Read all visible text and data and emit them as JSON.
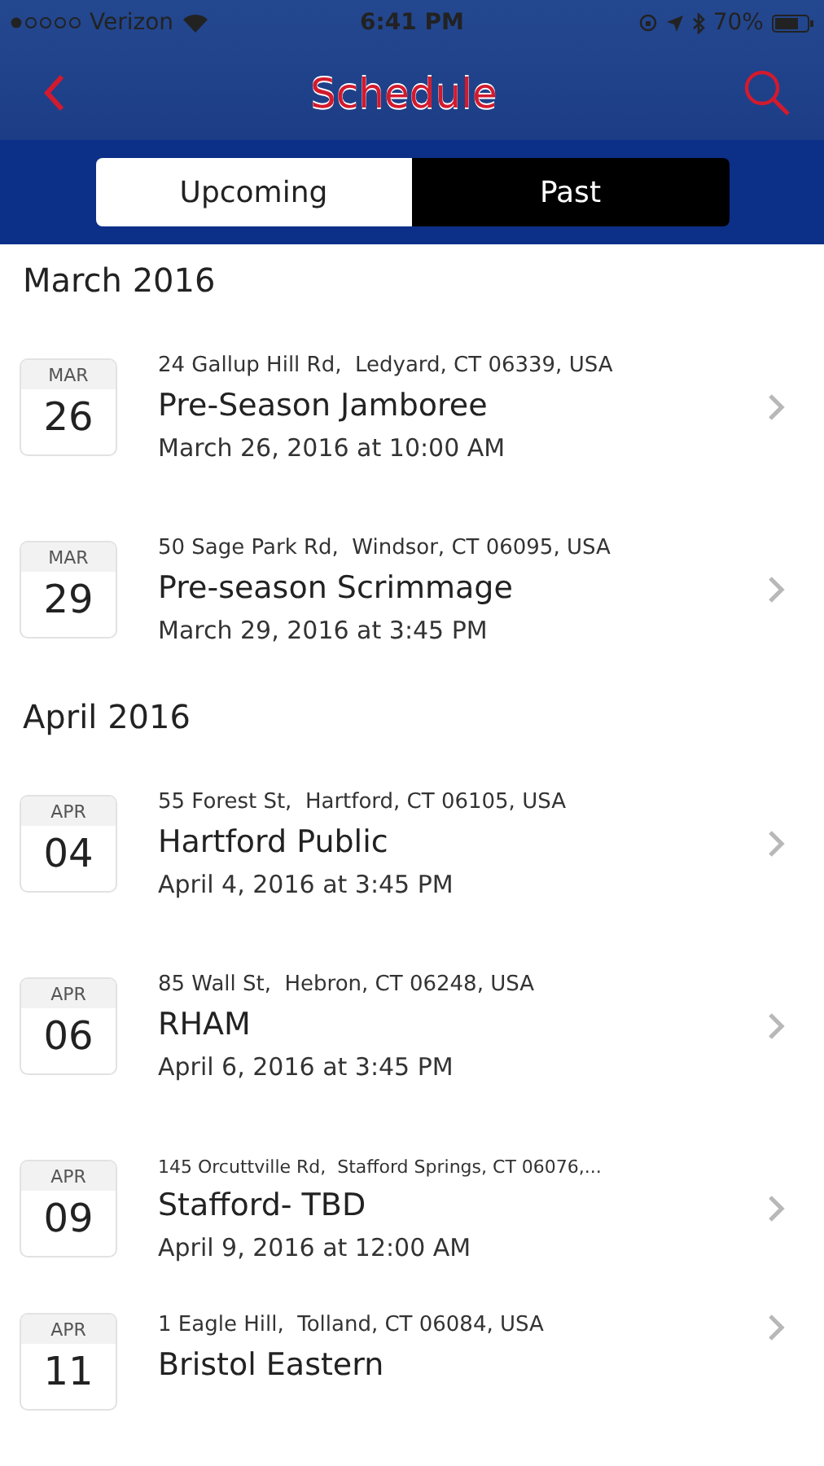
{
  "status_bar": {
    "carrier": "Verizon",
    "time": "6:41 PM",
    "battery": "70%"
  },
  "nav": {
    "title": "Schedule"
  },
  "tabs": [
    {
      "label": "Upcoming",
      "selected": false
    },
    {
      "label": "Past",
      "selected": true
    }
  ],
  "sections": [
    {
      "heading": "March 2016",
      "events": [
        {
          "month": "MAR",
          "day": "26",
          "address": "24 Gallup Hill Rd,  Ledyard, CT 06339, USA",
          "title": "Pre-Season Jamboree",
          "datetime": "March 26, 2016 at 10:00 AM"
        },
        {
          "month": "MAR",
          "day": "29",
          "address": "50 Sage Park Rd,  Windsor, CT 06095, USA",
          "title": "Pre-season Scrimmage",
          "datetime": "March 29, 2016 at 3:45 PM"
        }
      ]
    },
    {
      "heading": "April 2016",
      "events": [
        {
          "month": "APR",
          "day": "04",
          "address": "55 Forest St,  Hartford, CT 06105, USA",
          "title": "Hartford Public",
          "datetime": "April 4, 2016 at 3:45 PM"
        },
        {
          "month": "APR",
          "day": "06",
          "address": "85 Wall St,  Hebron, CT 06248, USA",
          "title": "RHAM",
          "datetime": "April 6, 2016 at 3:45 PM"
        },
        {
          "month": "APR",
          "day": "09",
          "address": "145 Orcuttville Rd,  Stafford Springs, CT 06076,...",
          "small": true,
          "title": "Stafford- TBD",
          "datetime": "April 9, 2016 at 12:00 AM"
        },
        {
          "month": "APR",
          "day": "11",
          "address": "1 Eagle Hill,  Tolland, CT 06084, USA",
          "title": "Bristol Eastern"
        }
      ]
    }
  ]
}
